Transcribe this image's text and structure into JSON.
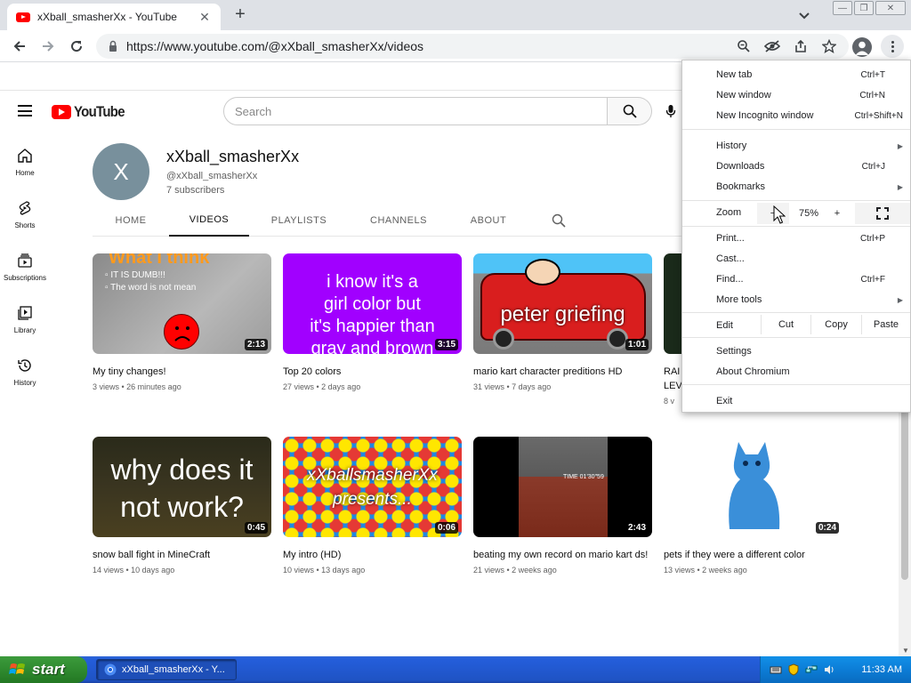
{
  "browser": {
    "tab_title": "xXball_smasherXx - YouTube",
    "url": "https://www.youtube.com/@xXball_smasherXx/videos",
    "window_buttons": [
      "—",
      "❐",
      "✕"
    ]
  },
  "youtube": {
    "logo_text": "YouTube",
    "search_placeholder": "Search",
    "guide": [
      "Home",
      "Shorts",
      "Subscriptions",
      "Library",
      "History"
    ],
    "channel": {
      "avatar_letter": "X",
      "name": "xXball_smasherXx",
      "handle": "@xXball_smasherXx",
      "subscribers": "7 subscribers"
    },
    "tabs": [
      "HOME",
      "VIDEOS",
      "PLAYLISTS",
      "CHANNELS",
      "ABOUT"
    ],
    "active_tab": "VIDEOS",
    "videos": [
      {
        "title": "My tiny changes!",
        "meta": "3 views • 26 minutes ago",
        "duration": "2:13",
        "thumb_lines": [
          "What I think",
          "▫ IT IS DUMB!!!",
          "▫ The word is not mean"
        ]
      },
      {
        "title": "Top 20 colors",
        "meta": "27 views • 2 days ago",
        "duration": "3:15",
        "thumb_lines": [
          "i know it's a",
          "girl color but",
          "it's happier than",
          "gray and brown"
        ]
      },
      {
        "title": "mario kart character preditions HD",
        "meta": "31 views • 7 days ago",
        "duration": "1:01",
        "thumb_lines": [
          "peter griefing"
        ]
      },
      {
        "title": "RAI",
        "title_line2": "LEV",
        "meta": "8 v",
        "duration": "",
        "thumb_lines": []
      },
      {
        "title": "snow ball fight in MineCraft",
        "meta": "14 views • 10 days ago",
        "duration": "0:45",
        "thumb_lines": [
          "why does it",
          "not work?"
        ]
      },
      {
        "title": "My intro (HD)",
        "meta": "10 views • 13 days ago",
        "duration": "0:06",
        "thumb_lines": [
          "xXballsmasherXx",
          "presents..."
        ]
      },
      {
        "title": "beating my own record on mario kart ds!",
        "meta": "21 views • 2 weeks ago",
        "duration": "2:43",
        "thumb_lines": [
          "TIME 01'30\"59"
        ]
      },
      {
        "title": "pets if they were a different color",
        "meta": "13 views • 2 weeks ago",
        "duration": "0:24",
        "thumb_lines": []
      }
    ]
  },
  "chrome_menu": {
    "new_tab": {
      "label": "New tab",
      "shortcut": "Ctrl+T"
    },
    "new_window": {
      "label": "New window",
      "shortcut": "Ctrl+N"
    },
    "new_incognito": {
      "label": "New Incognito window",
      "shortcut": "Ctrl+Shift+N"
    },
    "history": {
      "label": "History"
    },
    "downloads": {
      "label": "Downloads",
      "shortcut": "Ctrl+J"
    },
    "bookmarks": {
      "label": "Bookmarks"
    },
    "zoom": {
      "label": "Zoom",
      "minus": "−",
      "value": "75%",
      "plus": "+"
    },
    "print": {
      "label": "Print...",
      "shortcut": "Ctrl+P"
    },
    "cast": {
      "label": "Cast..."
    },
    "find": {
      "label": "Find...",
      "shortcut": "Ctrl+F"
    },
    "more_tools": {
      "label": "More tools"
    },
    "edit": {
      "label": "Edit",
      "cut": "Cut",
      "copy": "Copy",
      "paste": "Paste"
    },
    "settings": {
      "label": "Settings"
    },
    "about": {
      "label": "About Chromium"
    },
    "exit": {
      "label": "Exit"
    }
  },
  "taskbar": {
    "start_label": "start",
    "task_label": "xXball_smasherXx - Y...",
    "clock": "11:33 AM"
  },
  "colors": {
    "youtube_red": "#ff0000",
    "xp_blue": "#245edb",
    "xp_green": "#2f8a2f"
  }
}
